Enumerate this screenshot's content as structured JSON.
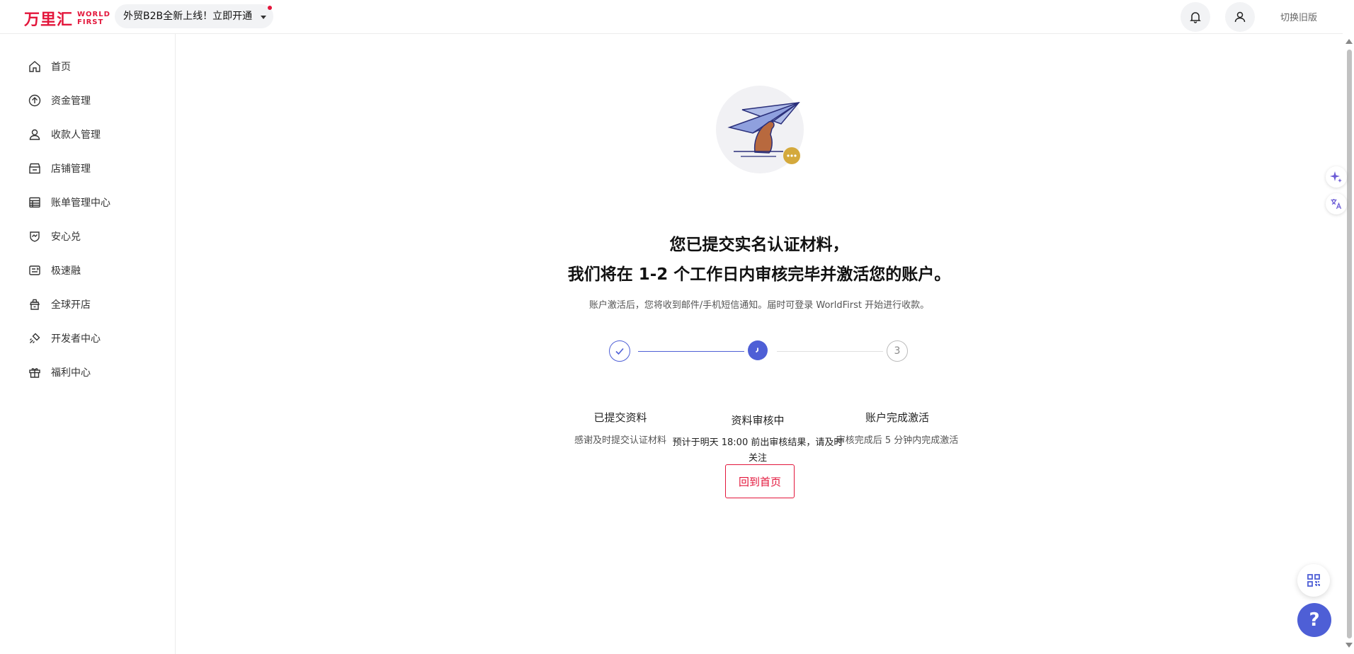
{
  "header": {
    "logo_cn": "万里汇",
    "logo_en_line1": "WORLD",
    "logo_en_line2": "FIRST",
    "promo_label": "外贸B2B全新上线！立即开通",
    "switch_old": "切换旧版"
  },
  "sidebar": {
    "items": [
      {
        "label": "首页",
        "icon": "home-icon"
      },
      {
        "label": "资金管理",
        "icon": "upload-circle-icon"
      },
      {
        "label": "收款人管理",
        "icon": "user-icon"
      },
      {
        "label": "店铺管理",
        "icon": "store-icon"
      },
      {
        "label": "账单管理中心",
        "icon": "bill-icon"
      },
      {
        "label": "安心兑",
        "icon": "exchange-icon"
      },
      {
        "label": "极速融",
        "icon": "finance-icon"
      },
      {
        "label": "全球开店",
        "icon": "global-shop-icon"
      },
      {
        "label": "开发者中心",
        "icon": "developer-icon"
      },
      {
        "label": "福利中心",
        "icon": "gift-icon"
      }
    ]
  },
  "main": {
    "heading_line1": "您已提交实名认证材料，",
    "heading_line2": "我们将在 1-2 个工作日内审核完毕并激活您的账户。",
    "subtext": "账户激活后，您将收到邮件/手机短信通知。届时可登录 WorldFirst 开始进行收款。",
    "steps": [
      {
        "title": "已提交资料",
        "desc": "感谢及时提交认证材料",
        "status": "done"
      },
      {
        "title": "资料审核中",
        "desc_line1": "预计于明天 18:00 前出审核结果，请及时",
        "desc_line2": "关注",
        "status": "active"
      },
      {
        "title": "账户完成激活",
        "desc": "审核完成后 5 分钟内完成激活",
        "number": "3",
        "status": "pending"
      }
    ],
    "home_button": "回到首页"
  },
  "floating": {
    "help": "?"
  },
  "colors": {
    "brand": "#e3163b",
    "primary": "#4e5fd6",
    "illustration_accent": "#d4a93c"
  }
}
